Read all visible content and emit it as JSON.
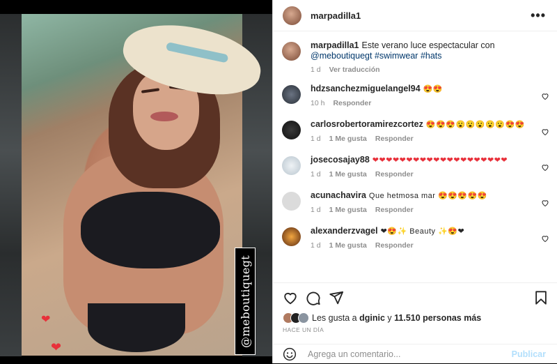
{
  "post": {
    "username": "marpadilla1",
    "more_label": "•••",
    "image_tag": "@meboutiquegt"
  },
  "caption": {
    "username": "marpadilla1",
    "text_a": "Este verano luce espectacular con",
    "mention": "@meboutiquegt",
    "hashtag1": "#swimwear",
    "hashtag2": "#hats",
    "time": "1 d",
    "translate": "Ver traducción"
  },
  "comments": [
    {
      "username": "hdzsanchezmiguelangel94",
      "text": "😍😍",
      "time": "10 h",
      "likes": "",
      "reply": "Responder"
    },
    {
      "username": "carlosrobertoramirezcortez",
      "text": "😍😍😍😮😮😮😮😮😍😍",
      "time": "1 d",
      "likes": "1 Me gusta",
      "reply": "Responder"
    },
    {
      "username": "josecosajay88",
      "text": "❤❤❤❤❤❤❤❤❤❤❤❤❤❤❤❤❤❤❤❤",
      "time": "1 d",
      "likes": "1 Me gusta",
      "reply": "Responder"
    },
    {
      "username": "acunachavira",
      "text": "Que hetmosa mar 😍😍😍😍😍",
      "time": "1 d",
      "likes": "1 Me gusta",
      "reply": "Responder"
    },
    {
      "username": "alexanderzvagel",
      "text": "❤😍✨ Beauty ✨😍❤",
      "time": "1 d",
      "likes": "1 Me gusta",
      "reply": "Responder"
    }
  ],
  "actions": {
    "likes_prefix": "Les gusta a",
    "likes_user": "dginic",
    "likes_and": "y",
    "likes_count": "11.510 personas más",
    "time": "HACE UN DÍA"
  },
  "comment_box": {
    "placeholder": "Agrega un comentario...",
    "publish": "Publicar"
  }
}
